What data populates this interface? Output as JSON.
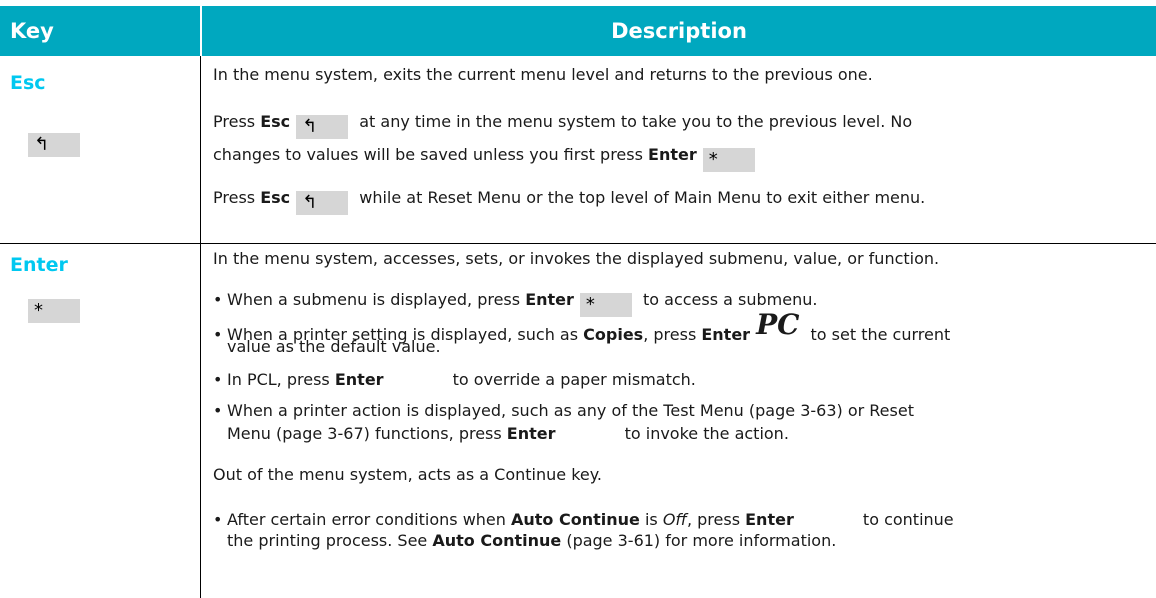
{
  "header": {
    "key": "Key",
    "description": "Description"
  },
  "esc": {
    "key_name": "Esc",
    "keycap_symbol": "↰",
    "intro": "In the menu system, exits the current menu level and returns to the previous one.",
    "p2": {
      "a": "Press ",
      "b": "Esc",
      "c": " at any time in the menu system to take you to the previous level. No",
      "d": "changes to values will be saved unless you first press ",
      "e": "Enter"
    },
    "p3": {
      "a": "Press ",
      "b": "Esc",
      "c": " while at Reset Menu or the top level of Main Menu to exit either menu."
    }
  },
  "enter": {
    "key_name": "Enter",
    "keycap_symbol": "*",
    "pc_symbol": "PC",
    "intro": "In the menu system, accesses, sets, or invokes the displayed submenu, value, or function.",
    "b1": {
      "a": "When a submenu is displayed, press ",
      "b": "Enter",
      "c": " to access a submenu."
    },
    "b2": {
      "a": "When a printer setting is displayed, such as ",
      "b": "Copies",
      "c": ", press ",
      "d": "Enter",
      "e": " to set the current",
      "f": "value as the default value."
    },
    "b3": {
      "a": "In PCL, press ",
      "b": "Enter",
      "c": " to override a paper mismatch."
    },
    "b4": {
      "a": "When a printer action is displayed, such as any of the Test Menu (page 3-63) or Reset",
      "b": "Menu (page 3-67) functions, press ",
      "c": "Enter",
      "d": " to invoke the action."
    },
    "continue_text": "Out of the menu system, acts as a Continue key.",
    "b5": {
      "a": "After certain error conditions when ",
      "b": "Auto Continue",
      "c": " is ",
      "d": "Off",
      "e": ", press ",
      "f": "Enter",
      "g": " to continue",
      "h": "the printing process. See ",
      "i": "Auto Continue",
      "j": " (page 3-61) for more information."
    }
  }
}
